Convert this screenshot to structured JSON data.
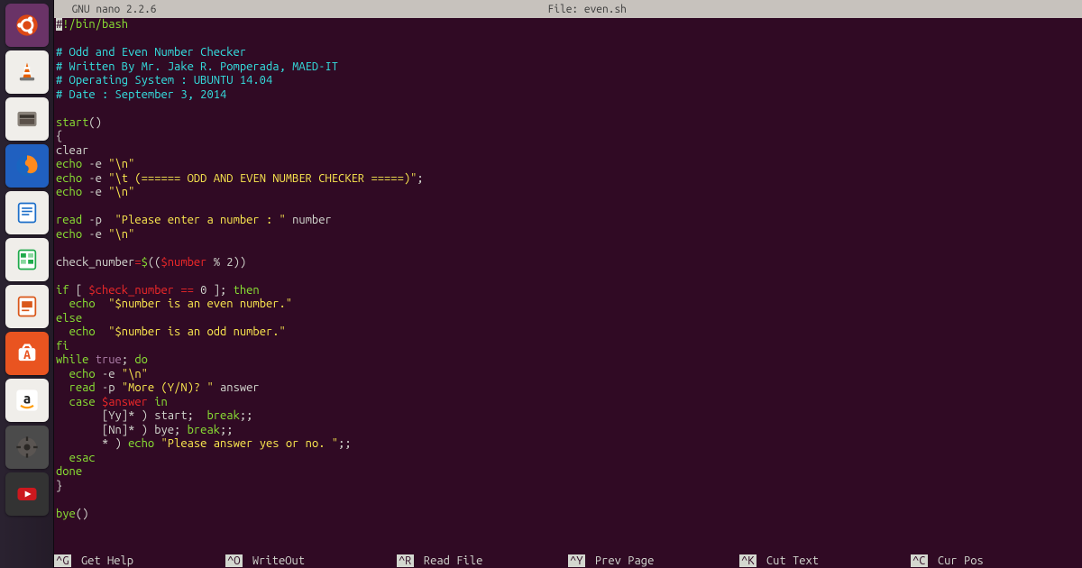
{
  "titlebar": {
    "left": "  GNU nano 2.2.6",
    "center": "File: even.sh"
  },
  "launcher": [
    {
      "name": "dash-icon",
      "bg": "#6a3367",
      "glyph": "ubuntu"
    },
    {
      "name": "vlc-icon",
      "bg": "#f0eeea",
      "glyph": "vlc"
    },
    {
      "name": "files-icon",
      "bg": "#f0eeea",
      "glyph": "files"
    },
    {
      "name": "firefox-icon",
      "bg": "#2060c0",
      "glyph": "firefox"
    },
    {
      "name": "writer-icon",
      "bg": "#f0eeea",
      "glyph": "writer"
    },
    {
      "name": "calc-icon",
      "bg": "#f0eeea",
      "glyph": "calc"
    },
    {
      "name": "impress-icon",
      "bg": "#f0eeea",
      "glyph": "impress"
    },
    {
      "name": "software-icon",
      "bg": "#e95420",
      "glyph": "software"
    },
    {
      "name": "amazon-icon",
      "bg": "#f0eeea",
      "glyph": "amazon"
    },
    {
      "name": "settings-icon",
      "bg": "#4b4b4b",
      "glyph": "settings"
    },
    {
      "name": "youtube-icon",
      "bg": "#333333",
      "glyph": "youtube"
    }
  ],
  "code": [
    [
      [
        "inv",
        "#"
      ],
      [
        "grn",
        "!/bin/bash"
      ]
    ],
    [],
    [
      [
        "cyn",
        "# Odd and Even Number Checker"
      ]
    ],
    [
      [
        "cyn",
        "# Written By Mr. Jake R. Pomperada, MAED-IT"
      ]
    ],
    [
      [
        "cyn",
        "# Operating System : UBUNTU 14.04"
      ]
    ],
    [
      [
        "cyn",
        "# Date : September 3, 2014"
      ]
    ],
    [],
    [
      [
        "grn",
        "start"
      ],
      [
        "wht",
        "()"
      ]
    ],
    [
      [
        "wht",
        "{"
      ]
    ],
    [
      [
        "wht",
        "clear"
      ]
    ],
    [
      [
        "grn",
        "echo"
      ],
      [
        "wht",
        " -e "
      ],
      [
        "yel",
        "\"\\n\""
      ]
    ],
    [
      [
        "grn",
        "echo"
      ],
      [
        "wht",
        " -e "
      ],
      [
        "yel",
        "\"\\t (====== ODD AND EVEN NUMBER CHECKER =====)\""
      ],
      [
        "wht",
        ";"
      ]
    ],
    [
      [
        "grn",
        "echo"
      ],
      [
        "wht",
        " -e "
      ],
      [
        "yel",
        "\"\\n\""
      ]
    ],
    [],
    [
      [
        "grn",
        "read"
      ],
      [
        "wht",
        " -p  "
      ],
      [
        "yel",
        "\"Please enter a number : \""
      ],
      [
        "wht",
        " number"
      ]
    ],
    [
      [
        "grn",
        "echo"
      ],
      [
        "wht",
        " -e "
      ],
      [
        "yel",
        "\"\\n\""
      ]
    ],
    [],
    [
      [
        "wht",
        "check_number"
      ],
      [
        "red",
        "="
      ],
      [
        "grn",
        "$"
      ],
      [
        "wht",
        "(("
      ],
      [
        "red",
        "$number"
      ],
      [
        "wht",
        " % 2))"
      ]
    ],
    [],
    [
      [
        "grn",
        "if"
      ],
      [
        "wht",
        " [ "
      ],
      [
        "red",
        "$check_number"
      ],
      [
        "wht",
        " "
      ],
      [
        "red",
        "=="
      ],
      [
        "wht",
        " 0 ]; "
      ],
      [
        "grn",
        "then"
      ]
    ],
    [
      [
        "wht",
        "  "
      ],
      [
        "grn",
        "echo"
      ],
      [
        "wht",
        "  "
      ],
      [
        "yel",
        "\"$number is an even number.\""
      ]
    ],
    [
      [
        "grn",
        "else"
      ]
    ],
    [
      [
        "wht",
        "  "
      ],
      [
        "grn",
        "echo"
      ],
      [
        "wht",
        "  "
      ],
      [
        "yel",
        "\"$number is an odd number.\""
      ]
    ],
    [
      [
        "grn",
        "fi"
      ]
    ],
    [
      [
        "grn",
        "while"
      ],
      [
        "wht",
        " "
      ],
      [
        "mag",
        "true"
      ],
      [
        "wht",
        "; "
      ],
      [
        "grn",
        "do"
      ]
    ],
    [
      [
        "wht",
        "  "
      ],
      [
        "grn",
        "echo"
      ],
      [
        "wht",
        " -e "
      ],
      [
        "yel",
        "\"\\n\""
      ]
    ],
    [
      [
        "wht",
        "  "
      ],
      [
        "grn",
        "read"
      ],
      [
        "wht",
        " -p "
      ],
      [
        "yel",
        "\"More (Y/N)? \""
      ],
      [
        "wht",
        " answer"
      ]
    ],
    [
      [
        "wht",
        "  "
      ],
      [
        "grn",
        "case"
      ],
      [
        "wht",
        " "
      ],
      [
        "red",
        "$answer"
      ],
      [
        "wht",
        " "
      ],
      [
        "grn",
        "in"
      ]
    ],
    [
      [
        "wht",
        "       [Yy]* ) start;  "
      ],
      [
        "grn",
        "break"
      ],
      [
        "wht",
        ";;"
      ]
    ],
    [
      [
        "wht",
        "       [Nn]* ) bye; "
      ],
      [
        "grn",
        "break"
      ],
      [
        "wht",
        ";;"
      ]
    ],
    [
      [
        "wht",
        "       * ) "
      ],
      [
        "grn",
        "echo"
      ],
      [
        "wht",
        " "
      ],
      [
        "yel",
        "\"Please answer yes or no. \""
      ],
      [
        "wht",
        ";;"
      ]
    ],
    [
      [
        "wht",
        "  "
      ],
      [
        "grn",
        "esac"
      ]
    ],
    [
      [
        "grn",
        "done"
      ]
    ],
    [
      [
        "wht",
        "}"
      ]
    ],
    [],
    [
      [
        "grn",
        "bye"
      ],
      [
        "wht",
        "()"
      ]
    ]
  ],
  "shortcuts": [
    {
      "key": "^G",
      "label": "Get Help"
    },
    {
      "key": "^O",
      "label": "WriteOut"
    },
    {
      "key": "^R",
      "label": "Read File"
    },
    {
      "key": "^Y",
      "label": "Prev Page"
    },
    {
      "key": "^K",
      "label": "Cut Text"
    },
    {
      "key": "^C",
      "label": "Cur Pos"
    }
  ]
}
